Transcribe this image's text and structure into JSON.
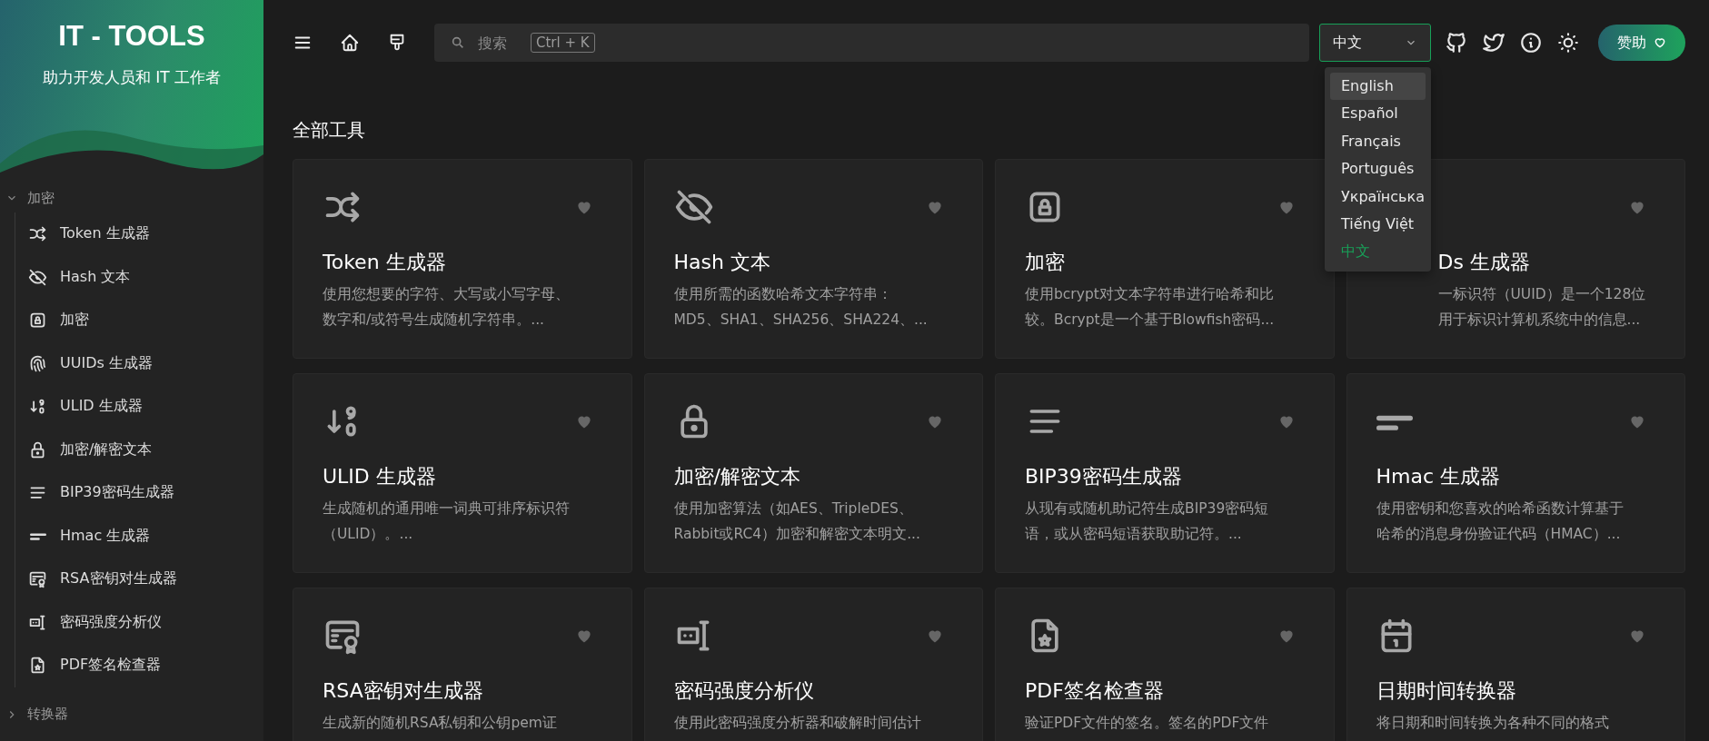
{
  "sidebar": {
    "title": "IT - TOOLS",
    "subtitle": "助力开发人员和 IT 工作者",
    "groups": [
      {
        "label": "加密",
        "expanded": true,
        "items": [
          {
            "label": "Token 生成器"
          },
          {
            "label": "Hash 文本"
          },
          {
            "label": "加密"
          },
          {
            "label": "UUIDs 生成器"
          },
          {
            "label": "ULID 生成器"
          },
          {
            "label": "加密/解密文本"
          },
          {
            "label": "BIP39密码生成器"
          },
          {
            "label": "Hmac 生成器"
          },
          {
            "label": "RSA密钥对生成器"
          },
          {
            "label": "密码强度分析仪"
          },
          {
            "label": "PDF签名检查器"
          }
        ]
      },
      {
        "label": "转换器",
        "expanded": false
      }
    ]
  },
  "topbar": {
    "search": {
      "placeholder": "搜索",
      "shortcut": "Ctrl + K"
    },
    "language": {
      "value": "中文",
      "open": true,
      "options": [
        {
          "label": "English",
          "highlighted": true,
          "selected": false
        },
        {
          "label": "Español",
          "highlighted": false,
          "selected": false
        },
        {
          "label": "Français",
          "highlighted": false,
          "selected": false
        },
        {
          "label": "Português",
          "highlighted": false,
          "selected": false
        },
        {
          "label": "Українська",
          "highlighted": false,
          "selected": false
        },
        {
          "label": "Tiếng Việt",
          "highlighted": false,
          "selected": false
        },
        {
          "label": "中文",
          "highlighted": false,
          "selected": true
        }
      ]
    },
    "donate_button": "赞助"
  },
  "section_title": "全部工具",
  "cards": [
    {
      "title": "Token 生成器",
      "lines": [
        "使用您想要的字符、大写或小写字母、",
        "数字和/或符号生成随机字符串。..."
      ],
      "partly_hidden": false
    },
    {
      "title": "Hash 文本",
      "lines": [
        "使用所需的函数哈希文本字符串：",
        "MD5、SHA1、SHA256、SHA224、..."
      ],
      "partly_hidden": false
    },
    {
      "title": "加密",
      "lines": [
        "使用bcrypt对文本字符串进行哈希和比",
        "较。Bcrypt是一个基于Blowfish密码..."
      ],
      "partly_hidden": false
    },
    {
      "title": "Ds 生成器",
      "lines": [
        "一标识符（UUID）是一个128位",
        "用于标识计算机系统中的信息..."
      ],
      "partly_hidden": true
    },
    {
      "title": "ULID 生成器",
      "lines": [
        "生成随机的通用唯一词典可排序标识符",
        "（ULID）。..."
      ],
      "partly_hidden": false
    },
    {
      "title": "加密/解密文本",
      "lines": [
        "使用加密算法（如AES、TripleDES、",
        "Rabbit或RC4）加密和解密文本明文..."
      ],
      "partly_hidden": false
    },
    {
      "title": "BIP39密码生成器",
      "lines": [
        "从现有或随机助记符生成BIP39密码短",
        "语，或从密码短语获取助记符。..."
      ],
      "partly_hidden": false
    },
    {
      "title": "Hmac 生成器",
      "lines": [
        "使用密钥和您喜欢的哈希函数计算基于",
        "哈希的消息身份验证代码（HMAC）..."
      ],
      "partly_hidden": false
    },
    {
      "title": "RSA密钥对生成器",
      "lines": [
        "生成新的随机RSA私钥和公钥pem证"
      ],
      "partly_hidden": false
    },
    {
      "title": "密码强度分析仪",
      "lines": [
        "使用此密码强度分析器和破解时间估计"
      ],
      "partly_hidden": false
    },
    {
      "title": "PDF签名检查器",
      "lines": [
        "验证PDF文件的签名。签名的PDF文件"
      ],
      "partly_hidden": false
    },
    {
      "title": "日期时间转换器",
      "lines": [
        "将日期和时间转换为各种不同的格式"
      ],
      "partly_hidden": false
    }
  ]
}
